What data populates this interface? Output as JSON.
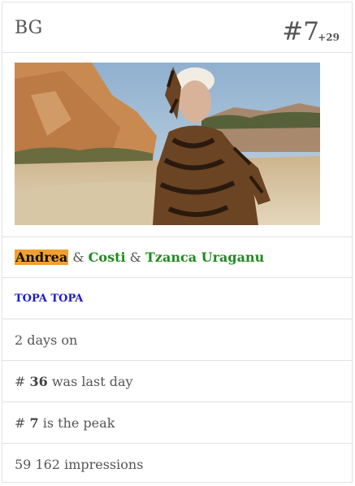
{
  "header": {
    "country": "BG",
    "rank": "#7",
    "rank_delta": "+29"
  },
  "image": {
    "icon": "artist-photo",
    "colors": {
      "sky": "#a7c1d8",
      "cliff": "#c98a52",
      "ground": "#d9c9a8",
      "outfit": "#5a3a1e"
    }
  },
  "artists": {
    "items": [
      {
        "name": "Andrea",
        "highlighted": true
      },
      {
        "name": "Costi",
        "highlighted": false
      },
      {
        "name": "Tzanca Uraganu",
        "highlighted": false
      }
    ],
    "separator": "&",
    "highlight_color": "#f0a030",
    "link_color": "#1f8b1f"
  },
  "song": {
    "title": "TOPA TOPA",
    "color": "#1a1ad0"
  },
  "stats": {
    "days_on": "2 days on",
    "last_day_prefix": "#",
    "last_day_value": "36",
    "last_day_suffix": "was last day",
    "peak_prefix": "#",
    "peak_value": "7",
    "peak_suffix": "is the peak",
    "impressions": "59 162 impressions"
  }
}
